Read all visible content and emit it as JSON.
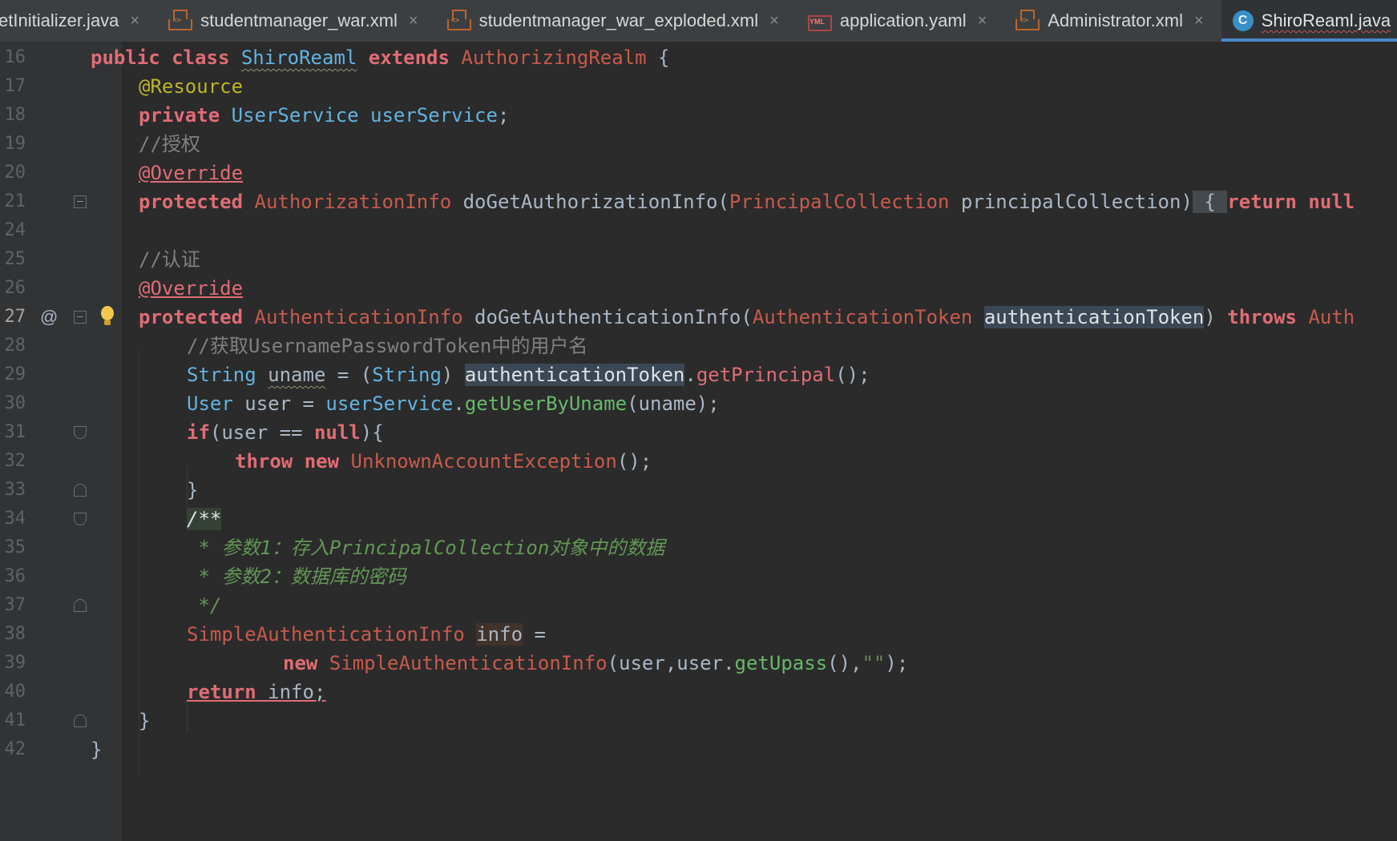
{
  "tabs": [
    {
      "label": "etInitializer.java",
      "icon": "java-class-icon",
      "active": false
    },
    {
      "label": "studentmanager_war.xml",
      "icon": "xml-file-icon",
      "active": false
    },
    {
      "label": "studentmanager_war_exploded.xml",
      "icon": "xml-file-icon",
      "active": false
    },
    {
      "label": "application.yaml",
      "icon": "yaml-file-icon",
      "active": false
    },
    {
      "label": "Administrator.xml",
      "icon": "xml-file-icon",
      "active": false
    },
    {
      "label": "ShiroReaml.java",
      "icon": "java-class-icon",
      "active": true
    }
  ],
  "tab_close_glyph": "×",
  "gutter": {
    "override_marker": "@",
    "line_numbers": [
      "16",
      "17",
      "18",
      "19",
      "20",
      "21",
      "24",
      "25",
      "26",
      "27",
      "28",
      "29",
      "30",
      "31",
      "32",
      "33",
      "34",
      "35",
      "36",
      "37",
      "38",
      "39",
      "40",
      "41",
      "42"
    ],
    "current_line": "27"
  },
  "code": {
    "l16": {
      "t1": "public class ",
      "t2": "ShiroReaml",
      "t3": " extends ",
      "t4": "AuthorizingRealm",
      "t5": " {"
    },
    "l17": {
      "t1": "@Resource"
    },
    "l18": {
      "t1": "private ",
      "t2": "UserService",
      "t3": " ",
      "t4": "userService",
      "t5": ";"
    },
    "l19": {
      "t1": "//授权"
    },
    "l20": {
      "t1": "@Override"
    },
    "l21": {
      "t1": "protected ",
      "t2": "AuthorizationInfo",
      "t3": " doGetAuthorizationInfo(",
      "t4": "PrincipalCollection",
      "t5": " principalCollection)",
      "t6": " { ",
      "t7": "return null"
    },
    "l25": {
      "t1": "//认证"
    },
    "l26": {
      "t1": "@Override"
    },
    "l27": {
      "t1": "protected ",
      "t2": "AuthenticationInfo",
      "t3": " doGetAuthenticationInfo(",
      "t4": "AuthenticationToken",
      "t5": " ",
      "t6": "authenticationToken",
      "t7": ") ",
      "t8": "throws ",
      "t9": "Auth"
    },
    "l28": {
      "t1": "//获取UsernamePasswordToken中的用户名"
    },
    "l29": {
      "t1": "String ",
      "t2": "uname",
      "t3": " = (",
      "t4": "String",
      "t5": ") ",
      "t6": "authenticationToken",
      "t7": ".",
      "t8": "getPrincipal",
      "t9": "();"
    },
    "l30": {
      "t1": "User ",
      "t2": "user = ",
      "t3": "userService",
      "t4": ".",
      "t5": "getUserByUname",
      "t6": "(uname);"
    },
    "l31": {
      "t1": "if",
      "t2": "(user == ",
      "t3": "null",
      "t4": "){"
    },
    "l32": {
      "t1": "throw new ",
      "t2": "UnknownAccountException",
      "t3": "();"
    },
    "l33": {
      "t1": "}"
    },
    "l34": {
      "t1": "/**"
    },
    "l35": {
      "t1": " * 参数1：存入PrincipalCollection对象中的数据"
    },
    "l36": {
      "t1": " * 参数2：数据库的密码"
    },
    "l37": {
      "t1": " */"
    },
    "l38": {
      "t1": "SimpleAuthenticationInfo",
      "t2": " ",
      "t3": "info",
      "t4": " ="
    },
    "l39": {
      "t1": "new ",
      "t2": "SimpleAuthenticationInfo",
      "t3": "(user,user.",
      "t4": "getUpass",
      "t5": "(),",
      "t6": "\"\"",
      "t7": ");"
    },
    "l40": {
      "t1": "return",
      "t2": " info;"
    },
    "l41": {
      "t1": "}"
    },
    "l42": {
      "t1": "}"
    }
  },
  "colors": {
    "keyword": "#cc7832",
    "type": "#c85a4c",
    "field": "#62b3e0",
    "method_call": "#67b96a",
    "comment": "#808080",
    "doc_comment": "#629755",
    "background": "#2b2b2b",
    "gutter": "#313335",
    "active_tab_underline": "#4a88c7"
  }
}
